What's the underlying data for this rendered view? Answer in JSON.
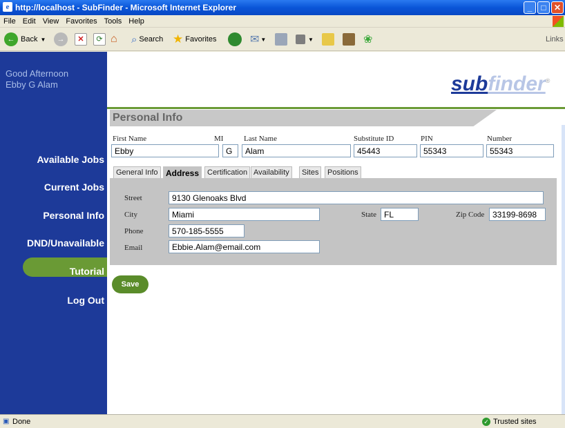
{
  "window": {
    "title": "http://localhost - SubFinder - Microsoft Internet Explorer"
  },
  "menu": [
    "File",
    "Edit",
    "View",
    "Favorites",
    "Tools",
    "Help"
  ],
  "toolbar": {
    "back": "Back",
    "search": "Search",
    "favorites": "Favorites",
    "links": "Links"
  },
  "sidebar": {
    "greeting": "Good Afternoon",
    "user_name": "Ebby G Alam",
    "nav": [
      "Available Jobs",
      "Current Jobs",
      "Personal Info",
      "DND/Unavailable",
      "Tutorial",
      "Log Out"
    ],
    "active": "Personal Info"
  },
  "logo": {
    "part1": "sub",
    "part2": "finder",
    "mark": "®"
  },
  "section_title": "Personal Info",
  "person": {
    "labels": {
      "first": "First Name",
      "mi": "MI",
      "last": "Last Name",
      "sub_id": "Substitute ID",
      "pin": "PIN",
      "number": "Number"
    },
    "values": {
      "first": "Ebby",
      "mi": "G",
      "last": "Alam",
      "sub_id": "45443",
      "pin": "55343",
      "number": "55343"
    }
  },
  "tabs": [
    "General Info",
    "Address",
    "Certification",
    "Availability",
    "Sites",
    "Positions"
  ],
  "active_tab": "Address",
  "address": {
    "labels": {
      "street": "Street",
      "city": "City",
      "state": "State",
      "zip": "Zip Code",
      "phone": "Phone",
      "email": "Email"
    },
    "values": {
      "street": "9130 Glenoaks Blvd",
      "city": "Miami",
      "state": "FL",
      "zip": "33199-8698",
      "phone": "570-185-5555",
      "email": "Ebbie.Alam@email.com"
    }
  },
  "save_label": "Save",
  "status": {
    "left": "Done",
    "right": "Trusted sites"
  },
  "colors": {
    "sidebar": "#1d3a99",
    "accent_green": "#6a9a35",
    "xp_blue": "#0a55d8"
  }
}
